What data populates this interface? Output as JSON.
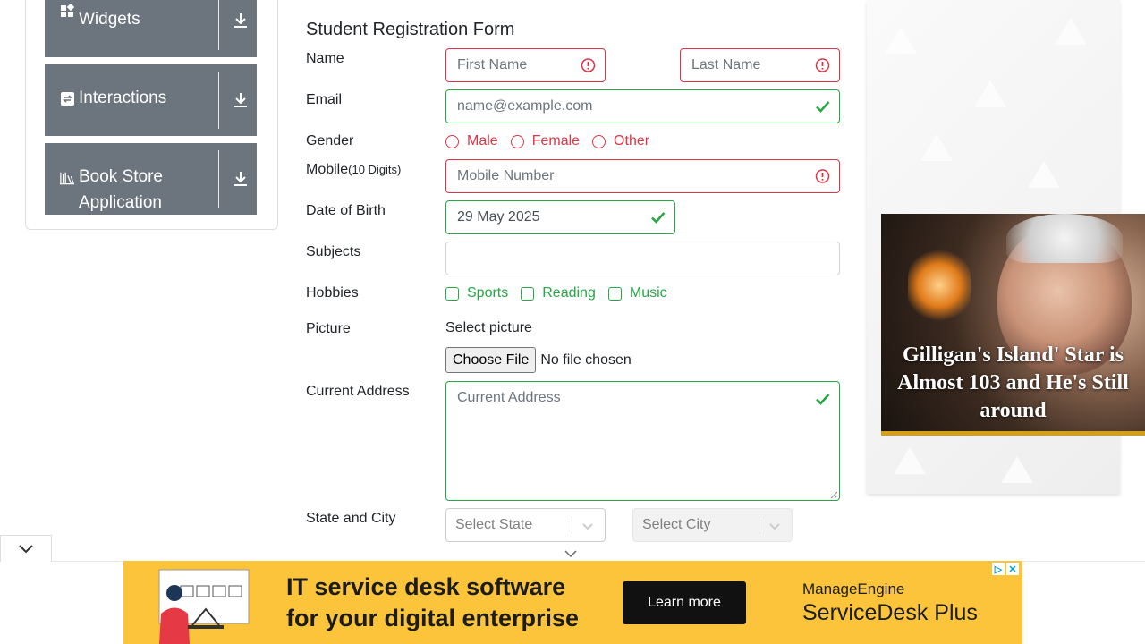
{
  "sidebar": {
    "groups": [
      {
        "label": "Widgets",
        "icon": "widgets-icon"
      },
      {
        "label": "Interactions",
        "icon": "interactions-icon"
      },
      {
        "label": "Book Store",
        "label2": "Application",
        "icon": "bookstore-icon"
      }
    ]
  },
  "form": {
    "title": "Student Registration Form",
    "labels": {
      "name": "Name",
      "email": "Email",
      "gender": "Gender",
      "mobile": "Mobile",
      "mobile_hint": "(10 Digits)",
      "dob": "Date of Birth",
      "subjects": "Subjects",
      "hobbies": "Hobbies",
      "picture": "Picture",
      "address": "Current Address",
      "state_city": "State and City"
    },
    "first_name_placeholder": "First Name",
    "last_name_placeholder": "Last Name",
    "email_placeholder": "name@example.com",
    "mobile_placeholder": "Mobile Number",
    "dob_value": "29 May 2025",
    "subjects_value": "",
    "gender_options": [
      "Male",
      "Female",
      "Other"
    ],
    "hobby_options": [
      "Sports",
      "Reading",
      "Music"
    ],
    "picture_prompt": "Select picture",
    "file_button": "Choose File",
    "file_status": "No file chosen",
    "address_placeholder": "Current Address",
    "state_placeholder": "Select State",
    "city_placeholder": "Select City"
  },
  "right_ad": {
    "headline": "Gilligan's Island' Star is Almost 103 and He's Still around"
  },
  "bottom_ad": {
    "headline_line1": "IT service desk software",
    "headline_line2": "for your digital enterprise",
    "cta": "Learn more",
    "brand_line1": "ManageEngine",
    "brand_line2": "ServiceDesk Plus"
  },
  "colors": {
    "invalid": "#dc3545",
    "valid": "#28a745",
    "sidebar": "#6c757d",
    "ad_yellow": "#fbc43b"
  }
}
